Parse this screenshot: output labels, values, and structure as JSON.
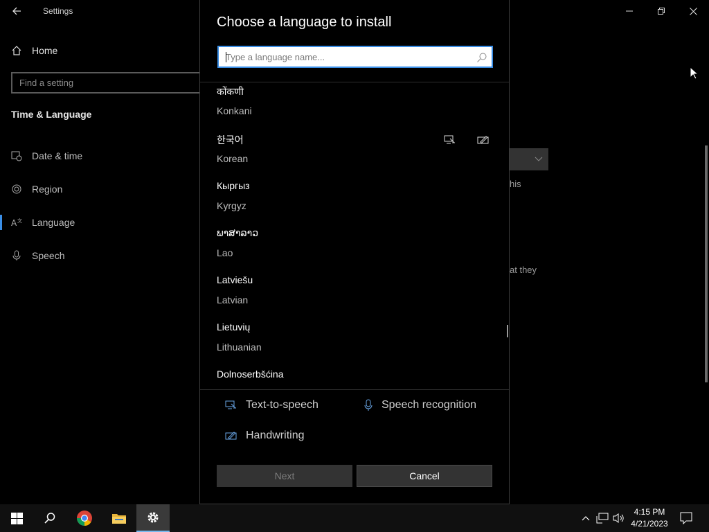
{
  "window": {
    "title": "Settings"
  },
  "sidebar": {
    "home": "Home",
    "search_placeholder": "Find a setting",
    "section_title": "Time & Language",
    "items": [
      {
        "label": "Date & time",
        "icon": "calendar-clock-icon"
      },
      {
        "label": "Region",
        "icon": "globe-icon"
      },
      {
        "label": "Language",
        "icon": "language-icon",
        "active": true
      },
      {
        "label": "Speech",
        "icon": "microphone-icon"
      }
    ]
  },
  "background_page": {
    "text_1": "his",
    "text_2": "at they"
  },
  "dialog": {
    "title": "Choose a language to install",
    "search_placeholder": "Type a language name...",
    "languages": [
      {
        "native": "कोंकणी",
        "english": "Konkani"
      },
      {
        "native": "한국어",
        "english": "Korean",
        "features": [
          "text-to-speech-icon",
          "handwriting-icon"
        ]
      },
      {
        "native": "Кыргыз",
        "english": "Kyrgyz"
      },
      {
        "native": "ພາສາລາວ",
        "english": "Lao"
      },
      {
        "native": "Latviešu",
        "english": "Latvian"
      },
      {
        "native": "Lietuvių",
        "english": "Lithuanian"
      },
      {
        "native": "Dolnoserbšćina",
        "english": ""
      }
    ],
    "legend": {
      "tts": "Text-to-speech",
      "speech": "Speech recognition",
      "handwriting": "Handwriting"
    },
    "buttons": {
      "next": "Next",
      "cancel": "Cancel"
    }
  },
  "taskbar": {
    "time": "4:15 PM",
    "date": "4/21/2023"
  },
  "colors": {
    "accent": "#3a8ee6",
    "background": "#000000",
    "button": "#333333"
  }
}
